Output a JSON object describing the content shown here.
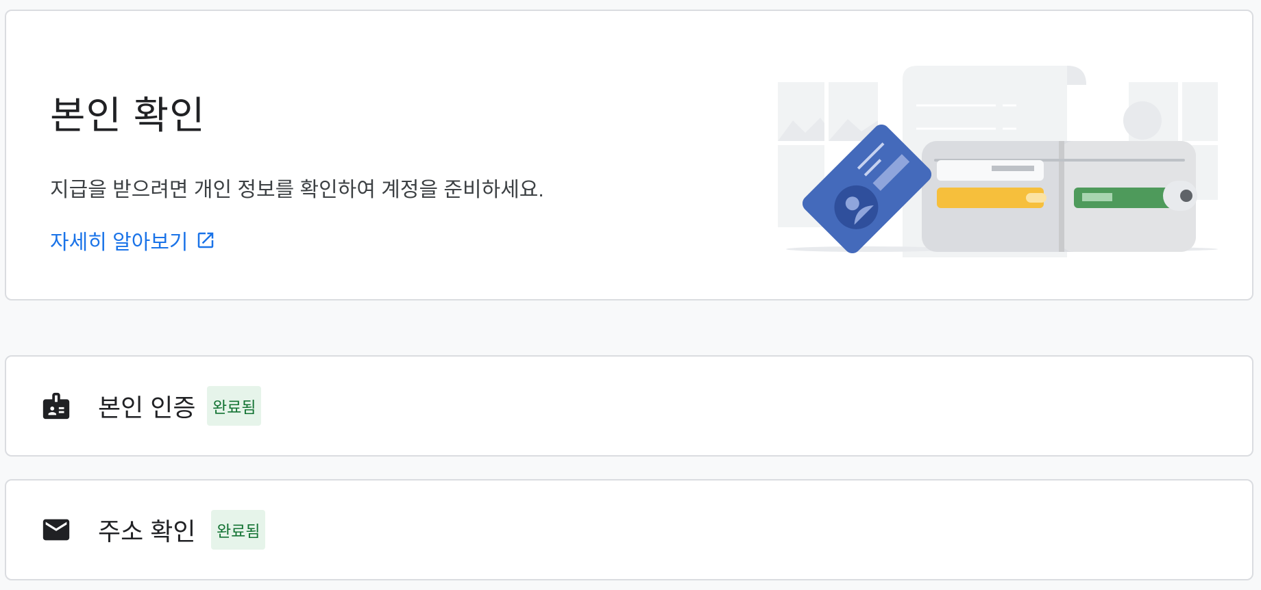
{
  "hero": {
    "title": "본인 확인",
    "description": "지급을 받으려면 개인 정보를 확인하여 계정을 준비하세요.",
    "learn_more": "자세히 알아보기",
    "link_color": "#1a73e8"
  },
  "verifications": [
    {
      "title": "본인 인증",
      "status": "완료됨",
      "icon": "id-badge-icon"
    },
    {
      "title": "주소 확인",
      "status": "완료됨",
      "icon": "mail-icon"
    }
  ],
  "colors": {
    "badge_bg": "#e6f4ea",
    "badge_text": "#137333",
    "card_border": "#dadce0",
    "page_bg": "#f8f9fa"
  }
}
